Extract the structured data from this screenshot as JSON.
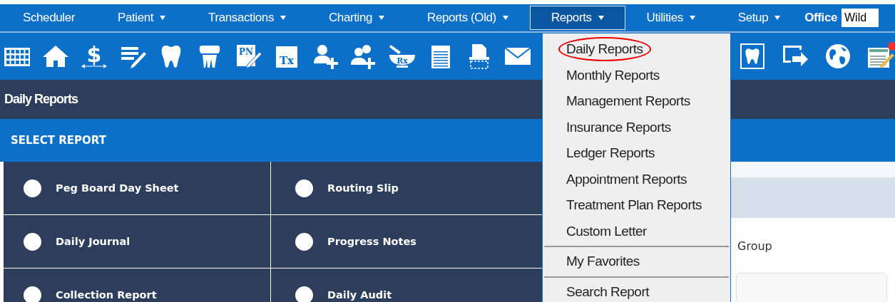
{
  "menu_bar": {
    "items": [
      {
        "label": "Scheduler",
        "has_menu": false,
        "selected": false
      },
      {
        "label": "Patient",
        "has_menu": true,
        "selected": false
      },
      {
        "label": "Transactions",
        "has_menu": true,
        "selected": false
      },
      {
        "label": "Charting",
        "has_menu": true,
        "selected": false
      },
      {
        "label": "Reports (Old)",
        "has_menu": true,
        "selected": false
      },
      {
        "label": "Reports",
        "has_menu": true,
        "selected": true
      },
      {
        "label": "Utilities",
        "has_menu": true,
        "selected": false
      },
      {
        "label": "Setup",
        "has_menu": true,
        "selected": false
      }
    ],
    "office_label": "Office",
    "office_value": "Wild"
  },
  "toolbar": {
    "left_icons": [
      {
        "kind": "calendar"
      },
      {
        "kind": "house"
      },
      {
        "kind": "dollar",
        "text": "$"
      },
      {
        "kind": "list-pencil"
      },
      {
        "kind": "tooth"
      },
      {
        "kind": "crown"
      },
      {
        "kind": "note-pencil",
        "text": "PN"
      },
      {
        "kind": "notepad",
        "text": "Tx"
      },
      {
        "kind": "person-add"
      },
      {
        "kind": "people-add"
      },
      {
        "kind": "mortar",
        "text": "Rx"
      },
      {
        "kind": "notepad-lines"
      },
      {
        "kind": "scanner"
      },
      {
        "kind": "envelope"
      }
    ],
    "right_icons": [
      {
        "kind": "tooth-frame"
      },
      {
        "kind": "screen-arrow"
      },
      {
        "kind": "globe"
      },
      {
        "kind": "sheet-pencil"
      }
    ]
  },
  "panel": {
    "title": "Daily Reports",
    "section": "SELECT REPORT",
    "reports": [
      {
        "label": "Peg Board Day Sheet",
        "selected": false
      },
      {
        "label": "Routing Slip",
        "selected": false
      },
      {
        "label": "Daily Journal",
        "selected": false
      },
      {
        "label": "Progress Notes",
        "selected": false
      },
      {
        "label": "Collection Report",
        "selected": false
      },
      {
        "label": "Daily Audit",
        "selected": false
      }
    ]
  },
  "side_pane": {
    "group_label": "Group"
  },
  "dropdown": {
    "items": [
      {
        "label": "Daily Reports",
        "circled": true,
        "divider_before": false
      },
      {
        "label": "Monthly Reports",
        "circled": false,
        "divider_before": false
      },
      {
        "label": "Management Reports",
        "circled": false,
        "divider_before": false
      },
      {
        "label": "Insurance Reports",
        "circled": false,
        "divider_before": false
      },
      {
        "label": "Ledger Reports",
        "circled": false,
        "divider_before": false
      },
      {
        "label": "Appointment Reports",
        "circled": false,
        "divider_before": false
      },
      {
        "label": "Treatment Plan Reports",
        "circled": false,
        "divider_before": false
      },
      {
        "label": "Custom Letter",
        "circled": false,
        "divider_before": false
      },
      {
        "label": "My Favorites",
        "circled": false,
        "divider_before": true
      },
      {
        "label": "Search Report",
        "circled": false,
        "divider_before": true
      }
    ]
  }
}
